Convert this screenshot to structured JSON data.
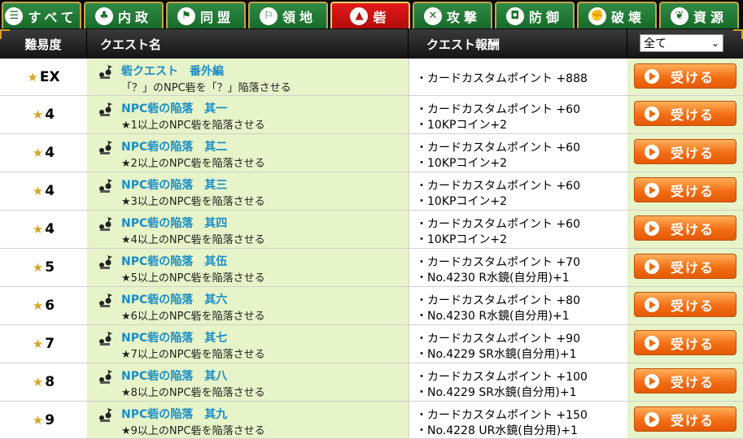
{
  "tabs": [
    {
      "icon": "list-icon",
      "glyph": "☰",
      "label": "すべて"
    },
    {
      "icon": "domestic-icon",
      "glyph": "♣",
      "label": "内政"
    },
    {
      "icon": "alliance-icon",
      "glyph": "⚑",
      "label": "同盟"
    },
    {
      "icon": "territory-icon",
      "glyph": "⚐",
      "label": "領地"
    },
    {
      "icon": "fort-icon",
      "glyph": "▲",
      "label": "砦"
    },
    {
      "icon": "attack-icon",
      "glyph": "✕",
      "label": "攻撃"
    },
    {
      "icon": "defense-icon",
      "glyph": "◘",
      "label": "防御"
    },
    {
      "icon": "destroy-icon",
      "glyph": "✊",
      "label": "破壊"
    },
    {
      "icon": "resource-icon",
      "glyph": "❦",
      "label": "資源"
    }
  ],
  "active_tab": "砦",
  "header": {
    "difficulty": "難易度",
    "quest_name": "クエスト名",
    "reward": "クエスト報酬",
    "filter_value": "全て"
  },
  "action_label": "受ける",
  "quests": [
    {
      "difficulty": "EX",
      "title": "砦クエスト　番外編",
      "desc": "「？」のNPC砦を「？」陥落させる",
      "rewards": [
        "・カードカスタムポイント +888"
      ]
    },
    {
      "difficulty": "4",
      "title": "NPC砦の陥落　其一",
      "desc": "★1以上のNPC砦を陥落させる",
      "rewards": [
        "・カードカスタムポイント +60",
        "・10KPコイン+2"
      ]
    },
    {
      "difficulty": "4",
      "title": "NPC砦の陥落　其二",
      "desc": "★2以上のNPC砦を陥落させる",
      "rewards": [
        "・カードカスタムポイント +60",
        "・10KPコイン+2"
      ]
    },
    {
      "difficulty": "4",
      "title": "NPC砦の陥落　其三",
      "desc": "★3以上のNPC砦を陥落させる",
      "rewards": [
        "・カードカスタムポイント +60",
        "・10KPコイン+2"
      ]
    },
    {
      "difficulty": "4",
      "title": "NPC砦の陥落　其四",
      "desc": "★4以上のNPC砦を陥落させる",
      "rewards": [
        "・カードカスタムポイント +60",
        "・10KPコイン+2"
      ]
    },
    {
      "difficulty": "5",
      "title": "NPC砦の陥落　其伍",
      "desc": "★5以上のNPC砦を陥落させる",
      "rewards": [
        "・カードカスタムポイント +70",
        "・No.4230 R水鏡(自分用)+1"
      ]
    },
    {
      "difficulty": "6",
      "title": "NPC砦の陥落　其六",
      "desc": "★6以上のNPC砦を陥落させる",
      "rewards": [
        "・カードカスタムポイント +80",
        "・No.4230 R水鏡(自分用)+1"
      ]
    },
    {
      "difficulty": "7",
      "title": "NPC砦の陥落　其七",
      "desc": "★7以上のNPC砦を陥落させる",
      "rewards": [
        "・カードカスタムポイント +90",
        "・No.4229 SR水鏡(自分用)+1"
      ]
    },
    {
      "difficulty": "8",
      "title": "NPC砦の陥落　其八",
      "desc": "★8以上のNPC砦を陥落させる",
      "rewards": [
        "・カードカスタムポイント +100",
        "・No.4229 SR水鏡(自分用)+1"
      ]
    },
    {
      "difficulty": "9",
      "title": "NPC砦の陥落　其九",
      "desc": "★9以上のNPC砦を陥落させる",
      "rewards": [
        "・カードカスタムポイント +150",
        "・No.4228 UR水鏡(自分用)+1"
      ]
    }
  ]
}
